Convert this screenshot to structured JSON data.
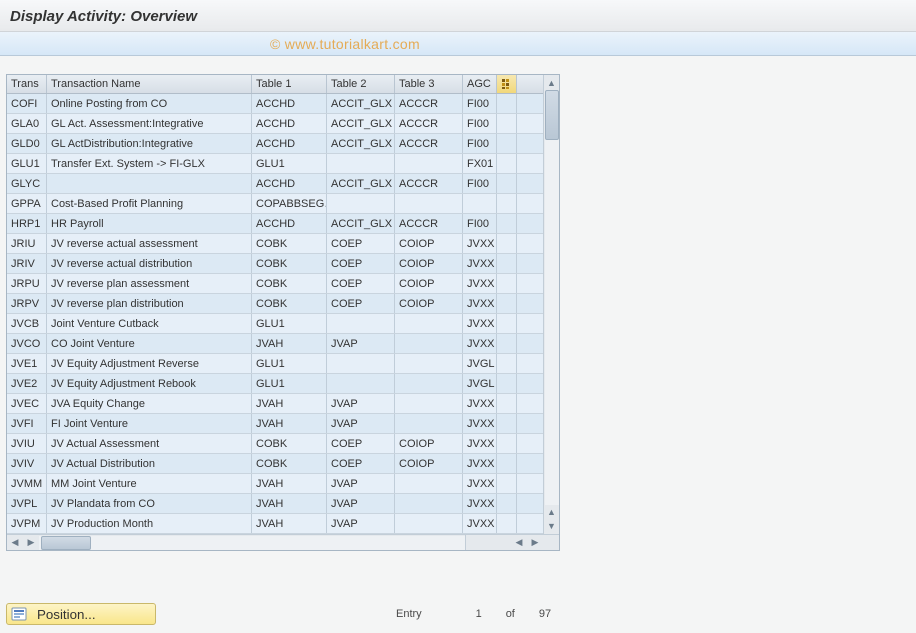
{
  "header": {
    "title": "Display Activity: Overview"
  },
  "watermark": "© www.tutorialkart.com",
  "columns": {
    "trans": "Trans",
    "name": "Transaction Name",
    "t1": "Table 1",
    "t2": "Table 2",
    "t3": "Table 3",
    "agc": "AGC"
  },
  "rows": [
    {
      "trans": "COFI",
      "name": "Online Posting from CO",
      "t1": "ACCHD",
      "t2": "ACCIT_GLX",
      "t3": "ACCCR",
      "agc": "FI00"
    },
    {
      "trans": "GLA0",
      "name": "GL Act. Assessment:Integrative",
      "t1": "ACCHD",
      "t2": "ACCIT_GLX",
      "t3": "ACCCR",
      "agc": "FI00"
    },
    {
      "trans": "GLD0",
      "name": "GL ActDistribution:Integrative",
      "t1": "ACCHD",
      "t2": "ACCIT_GLX",
      "t3": "ACCCR",
      "agc": "FI00"
    },
    {
      "trans": "GLU1",
      "name": "Transfer Ext. System -> FI-GLX",
      "t1": "GLU1",
      "t2": "",
      "t3": "",
      "agc": "FX01"
    },
    {
      "trans": "GLYC",
      "name": "",
      "t1": "ACCHD",
      "t2": "ACCIT_GLX",
      "t3": "ACCCR",
      "agc": "FI00"
    },
    {
      "trans": "GPPA",
      "name": "Cost-Based Profit Planning",
      "t1": "COPABBSEG…",
      "t2": "",
      "t3": "",
      "agc": ""
    },
    {
      "trans": "HRP1",
      "name": "HR Payroll",
      "t1": "ACCHD",
      "t2": "ACCIT_GLX",
      "t3": "ACCCR",
      "agc": "FI00"
    },
    {
      "trans": "JRIU",
      "name": "JV reverse actual assessment",
      "t1": "COBK",
      "t2": "COEP",
      "t3": "COIOP",
      "agc": "JVXX"
    },
    {
      "trans": "JRIV",
      "name": "JV reverse actual distribution",
      "t1": "COBK",
      "t2": "COEP",
      "t3": "COIOP",
      "agc": "JVXX"
    },
    {
      "trans": "JRPU",
      "name": "JV reverse plan assessment",
      "t1": "COBK",
      "t2": "COEP",
      "t3": "COIOP",
      "agc": "JVXX"
    },
    {
      "trans": "JRPV",
      "name": "JV reverse plan distribution",
      "t1": "COBK",
      "t2": "COEP",
      "t3": "COIOP",
      "agc": "JVXX"
    },
    {
      "trans": "JVCB",
      "name": "Joint Venture Cutback",
      "t1": "GLU1",
      "t2": "",
      "t3": "",
      "agc": "JVXX"
    },
    {
      "trans": "JVCO",
      "name": "CO Joint Venture",
      "t1": "JVAH",
      "t2": "JVAP",
      "t3": "",
      "agc": "JVXX"
    },
    {
      "trans": "JVE1",
      "name": "JV Equity Adjustment Reverse",
      "t1": "GLU1",
      "t2": "",
      "t3": "",
      "agc": "JVGL"
    },
    {
      "trans": "JVE2",
      "name": "JV Equity Adjustment Rebook",
      "t1": "GLU1",
      "t2": "",
      "t3": "",
      "agc": "JVGL"
    },
    {
      "trans": "JVEC",
      "name": "JVA Equity Change",
      "t1": "JVAH",
      "t2": "JVAP",
      "t3": "",
      "agc": "JVXX"
    },
    {
      "trans": "JVFI",
      "name": "FI Joint Venture",
      "t1": "JVAH",
      "t2": "JVAP",
      "t3": "",
      "agc": "JVXX"
    },
    {
      "trans": "JVIU",
      "name": "JV Actual Assessment",
      "t1": "COBK",
      "t2": "COEP",
      "t3": "COIOP",
      "agc": "JVXX"
    },
    {
      "trans": "JVIV",
      "name": "JV Actual Distribution",
      "t1": "COBK",
      "t2": "COEP",
      "t3": "COIOP",
      "agc": "JVXX"
    },
    {
      "trans": "JVMM",
      "name": "MM Joint Venture",
      "t1": "JVAH",
      "t2": "JVAP",
      "t3": "",
      "agc": "JVXX"
    },
    {
      "trans": "JVPL",
      "name": "JV Plandata from CO",
      "t1": "JVAH",
      "t2": "JVAP",
      "t3": "",
      "agc": "JVXX"
    },
    {
      "trans": "JVPM",
      "name": "JV Production Month",
      "t1": "JVAH",
      "t2": "JVAP",
      "t3": "",
      "agc": "JVXX"
    }
  ],
  "footer": {
    "position_label": "Position...",
    "entry_label": "Entry",
    "entry_current": "1",
    "entry_of": "of",
    "entry_total": "97"
  }
}
